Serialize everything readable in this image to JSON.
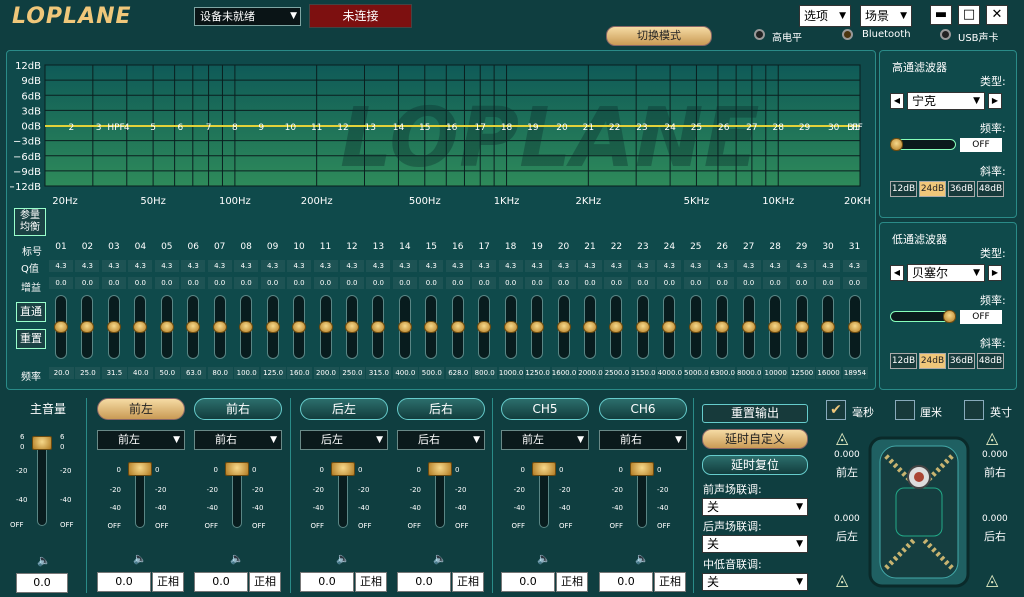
{
  "app": {
    "logo": "LOPLANE",
    "device_select": "设备未就绪",
    "connection_status": "未连接",
    "menu_options": "选项",
    "menu_scene": "场景",
    "switch_mode": "切换模式",
    "indicators": [
      "高电平",
      "Bluetooth",
      "USB声卡"
    ]
  },
  "eq_graph": {
    "db_labels": [
      "12dB",
      "9dB",
      "6dB",
      "3dB",
      "0dB",
      "−3dB",
      "−6dB",
      "−9dB",
      "−12dB"
    ],
    "band_labels": [
      "HPF",
      "2",
      "3",
      "4",
      "5",
      "6",
      "7",
      "8",
      "9",
      "10",
      "11",
      "12",
      "13",
      "14",
      "15",
      "16",
      "17",
      "18",
      "19",
      "20",
      "21",
      "22",
      "23",
      "24",
      "25",
      "26",
      "27",
      "28",
      "29",
      "30",
      "31",
      "LPF"
    ],
    "freq_labels": [
      "20Hz",
      "50Hz",
      "100Hz",
      "200Hz",
      "500Hz",
      "1KHz",
      "2KHz",
      "5KHz",
      "10KHz",
      "20KHz"
    ]
  },
  "eq_table": {
    "param_eq_button": "参量\n均衡",
    "row_labels": {
      "index": "标号",
      "q": "Q值",
      "gain": "增益",
      "freq": "频率"
    },
    "bypass_button": "直通",
    "reset_button": "重置",
    "bands": [
      "01",
      "02",
      "03",
      "04",
      "05",
      "06",
      "07",
      "08",
      "09",
      "10",
      "11",
      "12",
      "13",
      "14",
      "15",
      "16",
      "17",
      "18",
      "19",
      "20",
      "21",
      "22",
      "23",
      "24",
      "25",
      "26",
      "27",
      "28",
      "29",
      "30",
      "31"
    ],
    "q_values": [
      "4.3",
      "4.3",
      "4.3",
      "4.3",
      "4.3",
      "4.3",
      "4.3",
      "4.3",
      "4.3",
      "4.3",
      "4.3",
      "4.3",
      "4.3",
      "4.3",
      "4.3",
      "4.3",
      "4.3",
      "4.3",
      "4.3",
      "4.3",
      "4.3",
      "4.3",
      "4.3",
      "4.3",
      "4.3",
      "4.3",
      "4.3",
      "4.3",
      "4.3",
      "4.3",
      "4.3"
    ],
    "gains": [
      "0.0",
      "0.0",
      "0.0",
      "0.0",
      "0.0",
      "0.0",
      "0.0",
      "0.0",
      "0.0",
      "0.0",
      "0.0",
      "0.0",
      "0.0",
      "0.0",
      "0.0",
      "0.0",
      "0.0",
      "0.0",
      "0.0",
      "0.0",
      "0.0",
      "0.0",
      "0.0",
      "0.0",
      "0.0",
      "0.0",
      "0.0",
      "0.0",
      "0.0",
      "0.0",
      "0.0"
    ],
    "freqs": [
      "20.0",
      "25.0",
      "31.5",
      "40.0",
      "50.0",
      "63.0",
      "80.0",
      "100.0",
      "125.0",
      "160.0",
      "200.0",
      "250.0",
      "315.0",
      "400.0",
      "500.0",
      "628.0",
      "800.0",
      "1000.0",
      "1250.0",
      "1600.0",
      "2000.0",
      "2500.0",
      "3150.0",
      "4000.0",
      "5000.0",
      "6300.0",
      "8000.0",
      "10000",
      "12500",
      "16000",
      "18954"
    ]
  },
  "hpf": {
    "title": "高通滤波器",
    "type_label": "类型:",
    "type_value": "宁克",
    "freq_label": "频率:",
    "freq_value": "OFF",
    "slope_label": "斜率:",
    "slopes": [
      "12dB",
      "24dB",
      "36dB",
      "48dB"
    ],
    "slope_selected": "24dB"
  },
  "lpf": {
    "title": "低通滤波器",
    "type_label": "类型:",
    "type_value": "贝塞尔",
    "freq_label": "频率:",
    "freq_value": "OFF",
    "slope_label": "斜率:",
    "slopes": [
      "12dB",
      "24dB",
      "36dB",
      "48dB"
    ],
    "slope_selected": "24dB"
  },
  "master": {
    "title": "主音量",
    "scale": [
      "6",
      "0",
      "-20",
      "-40",
      "OFF"
    ],
    "value": "0.0"
  },
  "channels": [
    {
      "name": "前左",
      "route": "前左",
      "value": "0.0",
      "phase": "正相"
    },
    {
      "name": "前右",
      "route": "前右",
      "value": "0.0",
      "phase": "正相"
    },
    {
      "name": "后左",
      "route": "后左",
      "value": "0.0",
      "phase": "正相"
    },
    {
      "name": "后右",
      "route": "后右",
      "value": "0.0",
      "phase": "正相"
    },
    {
      "name": "CH5",
      "route": "前左",
      "value": "0.0",
      "phase": "正相"
    },
    {
      "name": "CH6",
      "route": "前右",
      "value": "0.0",
      "phase": "正相"
    }
  ],
  "ch_scale": [
    "0",
    "-20",
    "-40",
    "OFF"
  ],
  "delay": {
    "reset_output": "重置输出",
    "custom_delay": "延时自定义",
    "delay_reset": "延时复位",
    "front_link_label": "前声场联调:",
    "front_link_value": "关",
    "rear_link_label": "后声场联调:",
    "rear_link_value": "关",
    "sub_link_label": "中低音联调:",
    "sub_link_value": "关",
    "units": [
      "毫秒",
      "厘米",
      "英寸"
    ],
    "unit_selected": "毫秒",
    "front_left": {
      "value": "0.000",
      "label": "前左"
    },
    "front_right": {
      "value": "0.000",
      "label": "前右"
    },
    "rear_left": {
      "value": "0.000",
      "label": "后左"
    },
    "rear_right": {
      "value": "0.000",
      "label": "后右"
    }
  },
  "colors": {
    "accent_gold": "#f0c77a",
    "eq_curve": "#e3d23a",
    "bg": "#0f3e40",
    "status_red": "#8a0f0f"
  }
}
